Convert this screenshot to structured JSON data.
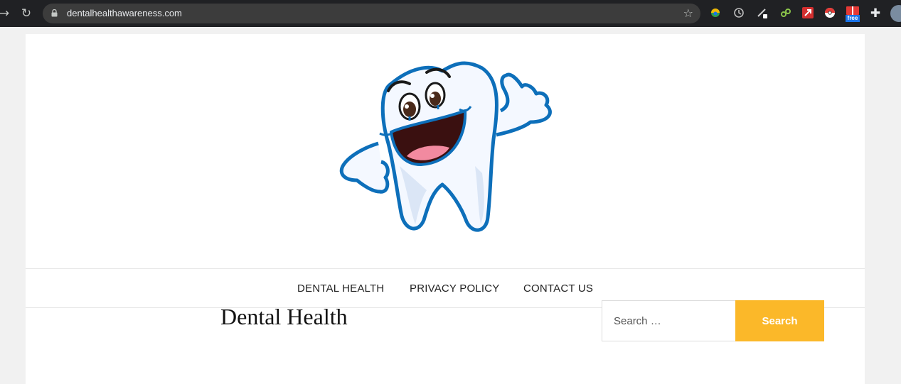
{
  "browser": {
    "url": "dentalhealthawareness.com",
    "extensions": {
      "badge_free": "free"
    }
  },
  "site": {
    "logo_icon": "tooth-mascot-thumbs-up"
  },
  "menu": {
    "items": [
      {
        "label": "DENTAL HEALTH"
      },
      {
        "label": "PRIVACY POLICY"
      },
      {
        "label": "CONTACT US"
      }
    ]
  },
  "content": {
    "title": "Dental Health"
  },
  "sidebar": {
    "search": {
      "placeholder": "Search …",
      "button_label": "Search"
    }
  },
  "colors": {
    "accent": "#fbb829",
    "tooth_outline": "#0d6fba",
    "chrome_bg": "#202124"
  }
}
